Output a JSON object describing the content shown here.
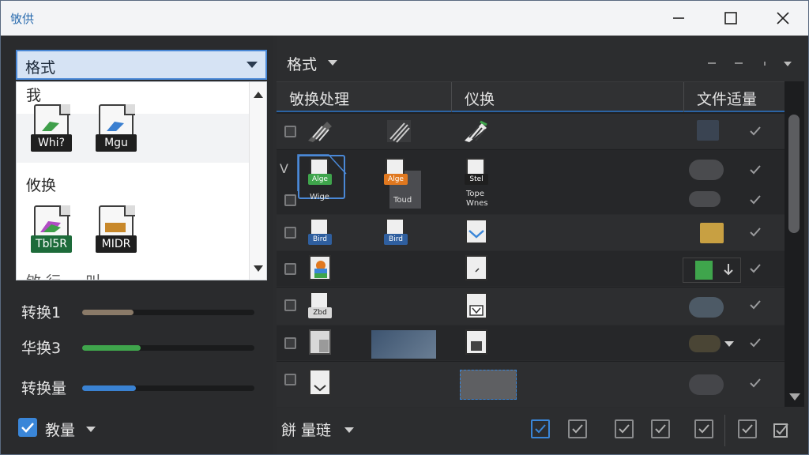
{
  "window": {
    "title": "敂供",
    "minimize_icon": "minimize-icon",
    "maximize_icon": "maximize-icon",
    "close_icon": "close-icon"
  },
  "left": {
    "dropdown_label": "格式",
    "groups": [
      {
        "title": "我",
        "files": [
          {
            "badge": "Whi?",
            "color": "#3f9f4a"
          },
          {
            "badge": "Mgu",
            "color": "#3a7fd0"
          }
        ]
      },
      {
        "title": "攸换",
        "files": [
          {
            "badge": "Tbl5R",
            "color": "#2e8a4a"
          },
          {
            "badge": "MIDR",
            "color": "#c8882a"
          }
        ]
      }
    ],
    "cut_text": "敂 行  ⋯ 叫",
    "sliders": [
      {
        "label": "转换1",
        "level": 0.3,
        "color": "#8a7a68"
      },
      {
        "label": "华换3",
        "level": 0.34,
        "color": "#3fa54c"
      },
      {
        "label": "转换量",
        "level": 0.31,
        "color": "#3a82d2"
      }
    ],
    "bottom_label": "教量"
  },
  "right": {
    "header_label": "格式",
    "columns": [
      "敂换处理",
      "仪换",
      "文件适量"
    ],
    "row_labels": [
      "Alge",
      "Wige",
      "Alge",
      "Stel",
      "Tope Wnes",
      "Bird",
      "Bird",
      "Zbd",
      "Toud",
      "V"
    ],
    "footer_label": "餅 量琏"
  },
  "colors": {
    "accent": "#3a86d8",
    "green": "#3fa54c",
    "orange": "#e0781f",
    "folder": "#c8a042"
  }
}
